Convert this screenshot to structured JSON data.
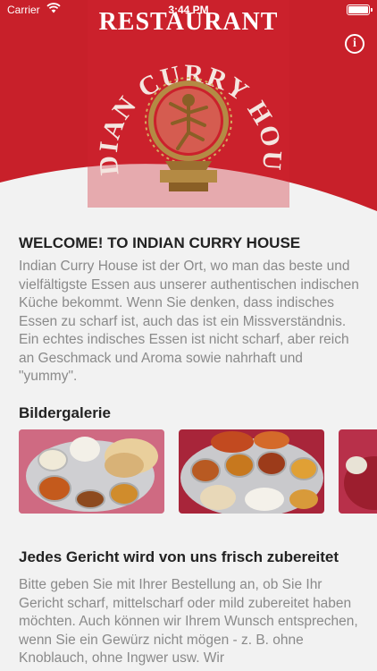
{
  "status_bar": {
    "carrier": "Carrier",
    "time": "3:44 PM"
  },
  "header": {
    "title": "RESTAURANT",
    "logo_arc_text": "INDIAN CURRY HOUSE",
    "brand_color": "#c8202a",
    "info_icon": "info-icon",
    "info_glyph": "i"
  },
  "welcome": {
    "title": "WELCOME! TO INDIAN CURRY HOUSE",
    "text": "Indian Curry House ist der Ort, wo man das beste und vielfältigste Essen aus unserer authentischen indischen Küche bekommt. Wenn Sie denken, dass indisches Essen zu scharf ist, auch das ist ein Missverständnis. Ein echtes indisches Essen ist nicht scharf, aber reich an Geschmack und Aroma sowie nahrhaft und \"yummy\"."
  },
  "gallery": {
    "title": "Bildergalerie",
    "items": [
      "gallery-photo-1",
      "gallery-photo-2",
      "gallery-photo-3"
    ]
  },
  "section2": {
    "title": "Jedes Gericht wird von uns frisch zubereitet",
    "text": "Bitte geben Sie mit Ihrer Bestellung an, ob Sie Ihr Gericht scharf, mittelscharf oder mild zubereitet haben möchten. Auch können wir Ihrem Wunsch entsprechen, wenn Sie ein Gewürz nicht mögen - z. B. ohne Knoblauch, ohne Ingwer usw. Wir"
  }
}
